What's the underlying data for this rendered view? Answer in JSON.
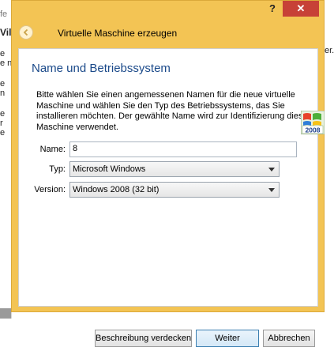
{
  "background_window": {
    "fragments": [
      {
        "text": "fe",
        "style": "gray"
      },
      {
        "text": "Vil",
        "style": "bold"
      },
      {
        "text": "e",
        "style": ""
      },
      {
        "text": "e n",
        "style": ""
      },
      {
        "text": "e",
        "style": ""
      },
      {
        "text": "n",
        "style": ""
      },
      {
        "text": "e",
        "style": ""
      },
      {
        "text": "r",
        "style": ""
      },
      {
        "text": "e",
        "style": ""
      }
    ],
    "right_fragment": "er."
  },
  "titlebar": {
    "help_label": "?",
    "close_label": "✕"
  },
  "header": {
    "title": "Virtuelle Maschine erzeugen",
    "back_icon": "back-arrow-icon"
  },
  "page": {
    "section_title": "Name und Betriebssystem",
    "description": "Bitte wählen Sie einen angemessenen Namen für die neue virtuelle Maschine und wählen Sie den Typ des Betriebssystems, das Sie installieren möchten. Der gewählte Name wird zur Identifizierung dieser Maschine verwendet.",
    "name": {
      "label": "Name:",
      "value": "8"
    },
    "type": {
      "label": "Typ:",
      "value": "Microsoft Windows"
    },
    "version": {
      "label": "Version:",
      "value": "Windows 2008 (32 bit)"
    },
    "os_icon": {
      "name": "windows-2008-icon",
      "badge": "2008"
    }
  },
  "buttons": {
    "hide_description": "Beschreibung verdecken",
    "next": "Weiter",
    "cancel": "Abbrechen"
  },
  "colors": {
    "frame": "#f3c454",
    "close": "#c74137",
    "section_title": "#1b4a8a"
  }
}
